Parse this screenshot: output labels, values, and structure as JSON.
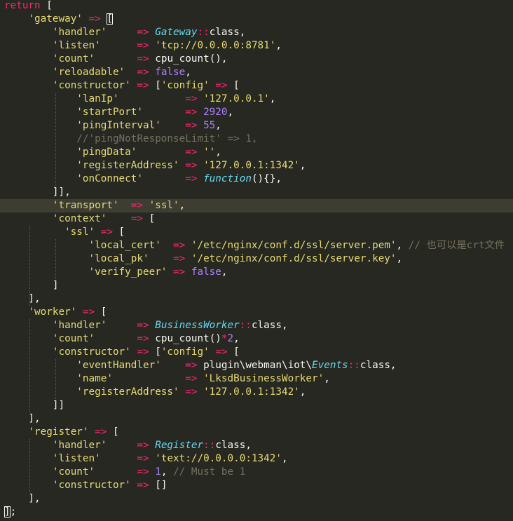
{
  "editor": {
    "theme_colors": {
      "background": "#272822",
      "keyword": "#f92672",
      "string": "#e6db74",
      "number": "#ae81ff",
      "class": "#66d9ef",
      "comment": "#75715e",
      "text": "#f8f8f2"
    },
    "lines": [
      {
        "t": [
          [
            "kw",
            "return"
          ],
          [
            "pl",
            " ["
          ]
        ]
      },
      {
        "t": [
          [
            "pl",
            "    "
          ],
          [
            "str",
            "'gateway'"
          ],
          [
            "pl",
            " "
          ],
          [
            "op",
            "=>"
          ],
          [
            "pl",
            " "
          ],
          [
            "br",
            "["
          ]
        ]
      },
      {
        "t": [
          [
            "pl",
            "        "
          ],
          [
            "str",
            "'handler'"
          ],
          [
            "pl",
            "     "
          ],
          [
            "op",
            "=>"
          ],
          [
            "pl",
            " "
          ],
          [
            "cls",
            "Gateway"
          ],
          [
            "op",
            "::"
          ],
          [
            "pl",
            "class,"
          ]
        ]
      },
      {
        "t": [
          [
            "pl",
            "        "
          ],
          [
            "str",
            "'listen'"
          ],
          [
            "pl",
            "      "
          ],
          [
            "op",
            "=>"
          ],
          [
            "pl",
            " "
          ],
          [
            "str",
            "'tcp://0.0.0.0:8781'"
          ],
          [
            "pl",
            ","
          ]
        ]
      },
      {
        "t": [
          [
            "pl",
            "        "
          ],
          [
            "str",
            "'count'"
          ],
          [
            "pl",
            "       "
          ],
          [
            "op",
            "=>"
          ],
          [
            "pl",
            " "
          ],
          [
            "fn",
            "cpu_count"
          ],
          [
            "pl",
            "(),"
          ]
        ]
      },
      {
        "t": [
          [
            "pl",
            "        "
          ],
          [
            "str",
            "'reloadable'"
          ],
          [
            "pl",
            "  "
          ],
          [
            "op",
            "=>"
          ],
          [
            "pl",
            " "
          ],
          [
            "num",
            "false"
          ],
          [
            "pl",
            ","
          ]
        ]
      },
      {
        "t": [
          [
            "pl",
            "        "
          ],
          [
            "str",
            "'constructor'"
          ],
          [
            "pl",
            " "
          ],
          [
            "op",
            "=>"
          ],
          [
            "pl",
            " ["
          ],
          [
            "str",
            "'config'"
          ],
          [
            "pl",
            " "
          ],
          [
            "op",
            "=>"
          ],
          [
            "pl",
            " ["
          ]
        ]
      },
      {
        "t": [
          [
            "pl",
            "            "
          ],
          [
            "str",
            "'lanIp'"
          ],
          [
            "pl",
            "           "
          ],
          [
            "op",
            "=>"
          ],
          [
            "pl",
            " "
          ],
          [
            "str",
            "'127.0.0.1'"
          ],
          [
            "pl",
            ","
          ]
        ]
      },
      {
        "t": [
          [
            "pl",
            "            "
          ],
          [
            "str",
            "'startPort'"
          ],
          [
            "pl",
            "       "
          ],
          [
            "op",
            "=>"
          ],
          [
            "pl",
            " "
          ],
          [
            "num",
            "2920"
          ],
          [
            "pl",
            ","
          ]
        ]
      },
      {
        "t": [
          [
            "pl",
            "            "
          ],
          [
            "str",
            "'pingInterval'"
          ],
          [
            "pl",
            "    "
          ],
          [
            "op",
            "=>"
          ],
          [
            "pl",
            " "
          ],
          [
            "num",
            "55"
          ],
          [
            "pl",
            ","
          ]
        ]
      },
      {
        "t": [
          [
            "pl",
            "            "
          ],
          [
            "cmt",
            "//'pingNotResponseLimit' => 1,"
          ]
        ]
      },
      {
        "t": [
          [
            "pl",
            "            "
          ],
          [
            "str",
            "'pingData'"
          ],
          [
            "pl",
            "        "
          ],
          [
            "op",
            "=>"
          ],
          [
            "pl",
            " "
          ],
          [
            "str",
            "''"
          ],
          [
            "pl",
            ","
          ]
        ]
      },
      {
        "t": [
          [
            "pl",
            "            "
          ],
          [
            "str",
            "'registerAddress'"
          ],
          [
            "pl",
            " "
          ],
          [
            "op",
            "=>"
          ],
          [
            "pl",
            " "
          ],
          [
            "str",
            "'127.0.0.1:1342'"
          ],
          [
            "pl",
            ","
          ]
        ]
      },
      {
        "t": [
          [
            "pl",
            "            "
          ],
          [
            "str",
            "'onConnect'"
          ],
          [
            "pl",
            "       "
          ],
          [
            "op",
            "=>"
          ],
          [
            "pl",
            " "
          ],
          [
            "cls",
            "function"
          ],
          [
            "pl",
            "(){},"
          ]
        ]
      },
      {
        "t": [
          [
            "pl",
            "        ]],"
          ]
        ]
      },
      {
        "t": [
          [
            "pl",
            "        "
          ],
          [
            "str",
            "'transport'"
          ],
          [
            "pl",
            "  "
          ],
          [
            "op",
            "=>"
          ],
          [
            "pl",
            " "
          ],
          [
            "str",
            "'ssl'"
          ],
          [
            "pl",
            ","
          ]
        ],
        "active": true
      },
      {
        "t": [
          [
            "pl",
            "        "
          ],
          [
            "str",
            "'context'"
          ],
          [
            "pl",
            "    "
          ],
          [
            "op",
            "=>"
          ],
          [
            "pl",
            " ["
          ]
        ]
      },
      {
        "t": [
          [
            "pl",
            "          "
          ],
          [
            "str",
            "'ssl'"
          ],
          [
            "pl",
            " "
          ],
          [
            "op",
            "=>"
          ],
          [
            "pl",
            " ["
          ]
        ]
      },
      {
        "t": [
          [
            "pl",
            "              "
          ],
          [
            "str",
            "'local_cert'"
          ],
          [
            "pl",
            "  "
          ],
          [
            "op",
            "=>"
          ],
          [
            "pl",
            " "
          ],
          [
            "str",
            "'/etc/nginx/conf.d/ssl/server.pem'"
          ],
          [
            "pl",
            ", "
          ],
          [
            "cmt",
            "// 也可以是crt文件"
          ]
        ]
      },
      {
        "t": [
          [
            "pl",
            "              "
          ],
          [
            "str",
            "'local_pk'"
          ],
          [
            "pl",
            "    "
          ],
          [
            "op",
            "=>"
          ],
          [
            "pl",
            " "
          ],
          [
            "str",
            "'/etc/nginx/conf.d/ssl/server.key'"
          ],
          [
            "pl",
            ","
          ]
        ]
      },
      {
        "t": [
          [
            "pl",
            "              "
          ],
          [
            "str",
            "'verify_peer'"
          ],
          [
            "pl",
            " "
          ],
          [
            "op",
            "=>"
          ],
          [
            "pl",
            " "
          ],
          [
            "num",
            "false"
          ],
          [
            "pl",
            ","
          ]
        ]
      },
      {
        "t": [
          [
            "pl",
            "        ]"
          ]
        ]
      },
      {
        "t": [
          [
            "pl",
            "    ],"
          ]
        ]
      },
      {
        "t": [
          [
            "pl",
            "    "
          ],
          [
            "str",
            "'worker'"
          ],
          [
            "pl",
            " "
          ],
          [
            "op",
            "=>"
          ],
          [
            "pl",
            " ["
          ]
        ]
      },
      {
        "t": [
          [
            "pl",
            "        "
          ],
          [
            "str",
            "'handler'"
          ],
          [
            "pl",
            "     "
          ],
          [
            "op",
            "=>"
          ],
          [
            "pl",
            " "
          ],
          [
            "cls",
            "BusinessWorker"
          ],
          [
            "op",
            "::"
          ],
          [
            "pl",
            "class,"
          ]
        ]
      },
      {
        "t": [
          [
            "pl",
            "        "
          ],
          [
            "str",
            "'count'"
          ],
          [
            "pl",
            "       "
          ],
          [
            "op",
            "=>"
          ],
          [
            "pl",
            " "
          ],
          [
            "fn",
            "cpu_count"
          ],
          [
            "pl",
            "()"
          ],
          [
            "op",
            "*"
          ],
          [
            "num",
            "2"
          ],
          [
            "pl",
            ","
          ]
        ]
      },
      {
        "t": [
          [
            "pl",
            "        "
          ],
          [
            "str",
            "'constructor'"
          ],
          [
            "pl",
            " "
          ],
          [
            "op",
            "=>"
          ],
          [
            "pl",
            " ["
          ],
          [
            "str",
            "'config'"
          ],
          [
            "pl",
            " "
          ],
          [
            "op",
            "=>"
          ],
          [
            "pl",
            " ["
          ]
        ]
      },
      {
        "t": [
          [
            "pl",
            "            "
          ],
          [
            "str",
            "'eventHandler'"
          ],
          [
            "pl",
            "    "
          ],
          [
            "op",
            "=>"
          ],
          [
            "pl",
            " plugin\\webman\\iot\\"
          ],
          [
            "cls",
            "Events"
          ],
          [
            "op",
            "::"
          ],
          [
            "pl",
            "class,"
          ]
        ]
      },
      {
        "t": [
          [
            "pl",
            "            "
          ],
          [
            "str",
            "'name'"
          ],
          [
            "pl",
            "            "
          ],
          [
            "op",
            "=>"
          ],
          [
            "pl",
            " "
          ],
          [
            "str",
            "'LksdBusinessWorker'"
          ],
          [
            "pl",
            ","
          ]
        ]
      },
      {
        "t": [
          [
            "pl",
            "            "
          ],
          [
            "str",
            "'registerAddress'"
          ],
          [
            "pl",
            " "
          ],
          [
            "op",
            "=>"
          ],
          [
            "pl",
            " "
          ],
          [
            "str",
            "'127.0.0.1:1342'"
          ],
          [
            "pl",
            ","
          ]
        ]
      },
      {
        "t": [
          [
            "pl",
            "        ]]"
          ]
        ]
      },
      {
        "t": [
          [
            "pl",
            "    ],"
          ]
        ]
      },
      {
        "t": [
          [
            "pl",
            "    "
          ],
          [
            "str",
            "'register'"
          ],
          [
            "pl",
            " "
          ],
          [
            "op",
            "=>"
          ],
          [
            "pl",
            " ["
          ]
        ]
      },
      {
        "t": [
          [
            "pl",
            "        "
          ],
          [
            "str",
            "'handler'"
          ],
          [
            "pl",
            "     "
          ],
          [
            "op",
            "=>"
          ],
          [
            "pl",
            " "
          ],
          [
            "cls",
            "Register"
          ],
          [
            "op",
            "::"
          ],
          [
            "pl",
            "class,"
          ]
        ]
      },
      {
        "t": [
          [
            "pl",
            "        "
          ],
          [
            "str",
            "'listen'"
          ],
          [
            "pl",
            "      "
          ],
          [
            "op",
            "=>"
          ],
          [
            "pl",
            " "
          ],
          [
            "str",
            "'text://0.0.0.0:1342'"
          ],
          [
            "pl",
            ","
          ]
        ]
      },
      {
        "t": [
          [
            "pl",
            "        "
          ],
          [
            "str",
            "'count'"
          ],
          [
            "pl",
            "       "
          ],
          [
            "op",
            "=>"
          ],
          [
            "pl",
            " "
          ],
          [
            "num",
            "1"
          ],
          [
            "pl",
            ", "
          ],
          [
            "cmt",
            "// Must be 1"
          ]
        ]
      },
      {
        "t": [
          [
            "pl",
            "        "
          ],
          [
            "str",
            "'constructor'"
          ],
          [
            "pl",
            " "
          ],
          [
            "op",
            "=>"
          ],
          [
            "pl",
            " []"
          ]
        ]
      },
      {
        "t": [
          [
            "pl",
            "    ],"
          ]
        ]
      },
      {
        "t": [
          [
            "br",
            "]"
          ],
          [
            "pl",
            ";"
          ]
        ]
      }
    ]
  }
}
